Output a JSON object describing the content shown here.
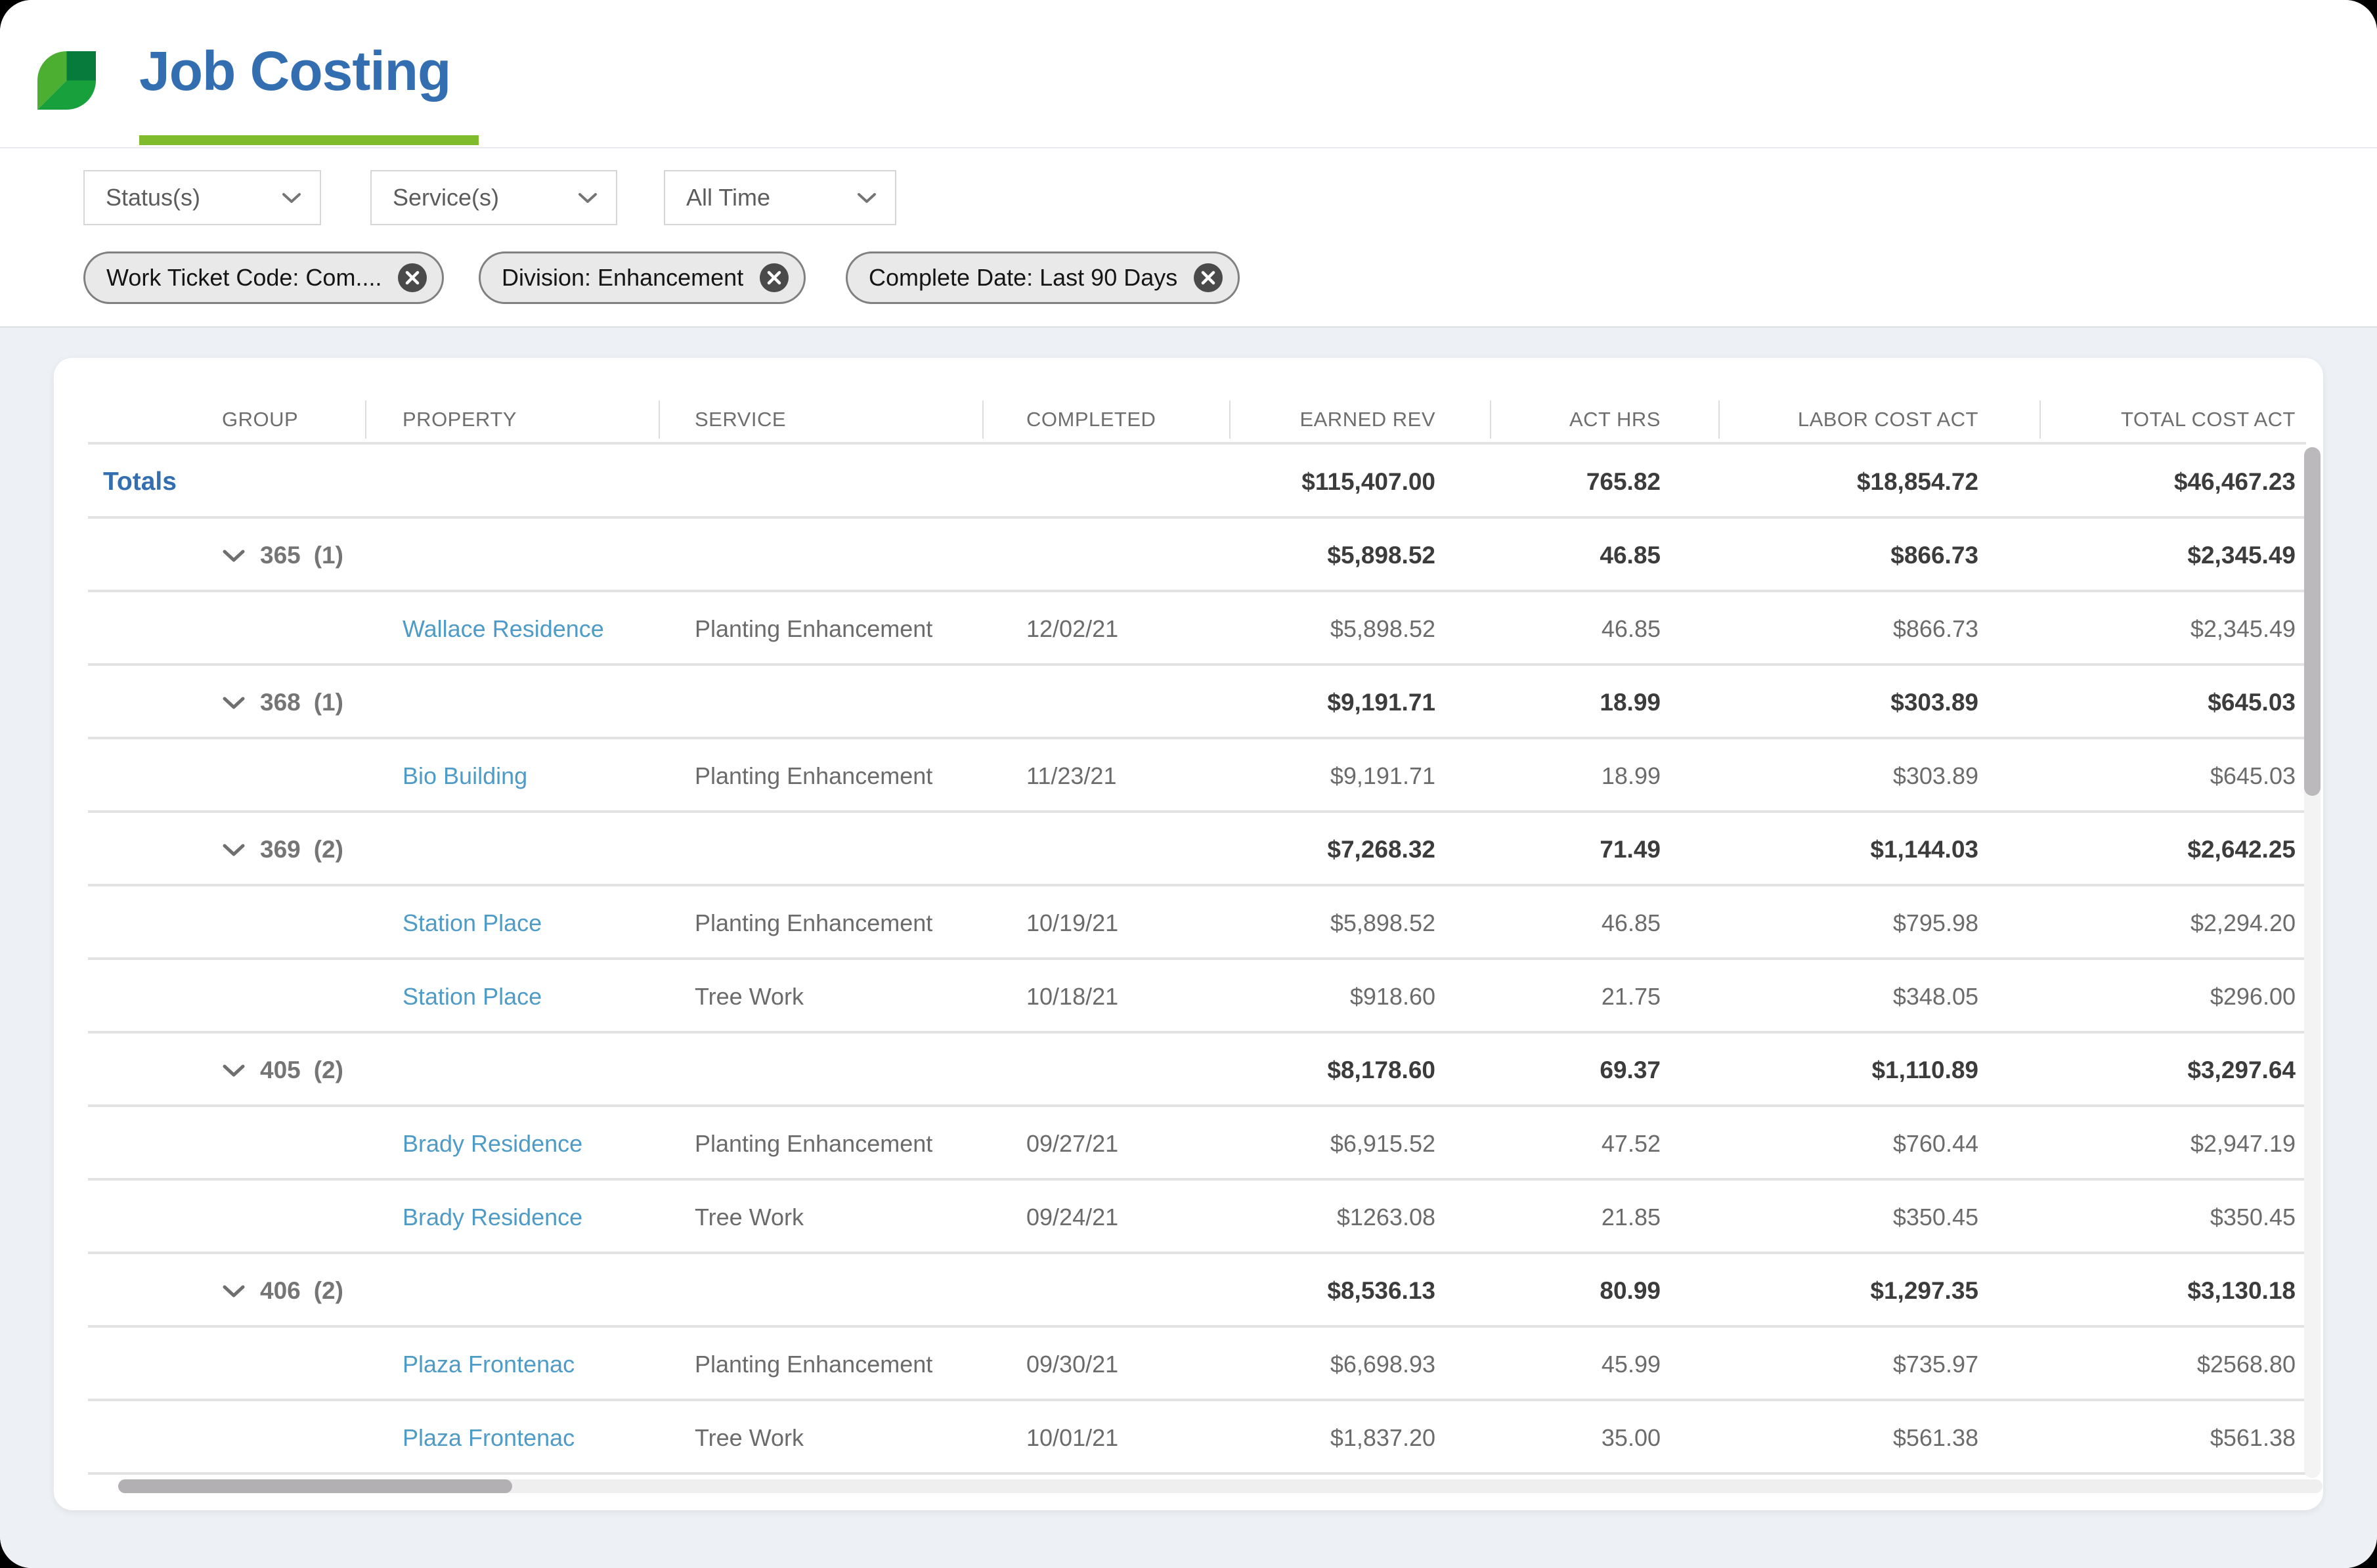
{
  "app": {
    "title": "Job Costing"
  },
  "colors": {
    "title_blue": "#336FB0",
    "brand_green_underline": "#80BB2D",
    "leaf_light_green": "#4DAF31",
    "leaf_mid_green": "#18A03C",
    "leaf_dark_green": "#077B3B",
    "link_blue": "#4E9BC8"
  },
  "filters": {
    "dropdowns": [
      {
        "label": "Status(s)"
      },
      {
        "label": "Service(s)"
      },
      {
        "label": "All Time"
      }
    ],
    "chips": [
      {
        "label": "Work Ticket Code: Com...."
      },
      {
        "label": "Division: Enhancement"
      },
      {
        "label": "Complete Date: Last 90 Days"
      }
    ]
  },
  "table": {
    "columns": [
      "GROUP",
      "PROPERTY",
      "SERVICE",
      "COMPLETED",
      "EARNED REV",
      "ACT HRS",
      "LABOR COST ACT",
      "TOTAL COST ACT"
    ],
    "totals": {
      "label": "Totals",
      "earned_rev": "$115,407.00",
      "act_hrs": "765.82",
      "labor_cost_act": "$18,854.72",
      "total_cost_act": "$46,467.23"
    },
    "rows": [
      {
        "type": "group",
        "group": "365",
        "count": "(1)",
        "earned_rev": "$5,898.52",
        "act_hrs": "46.85",
        "labor_cost_act": "$866.73",
        "total_cost_act": "$2,345.49"
      },
      {
        "type": "detail",
        "property": "Wallace Residence",
        "service": "Planting Enhancement",
        "completed": "12/02/21",
        "earned_rev": "$5,898.52",
        "act_hrs": "46.85",
        "labor_cost_act": "$866.73",
        "total_cost_act": "$2,345.49"
      },
      {
        "type": "group",
        "group": "368",
        "count": "(1)",
        "earned_rev": "$9,191.71",
        "act_hrs": "18.99",
        "labor_cost_act": "$303.89",
        "total_cost_act": "$645.03"
      },
      {
        "type": "detail",
        "property": "Bio Building",
        "service": "Planting Enhancement",
        "completed": "11/23/21",
        "earned_rev": "$9,191.71",
        "act_hrs": "18.99",
        "labor_cost_act": "$303.89",
        "total_cost_act": "$645.03"
      },
      {
        "type": "group",
        "group": "369",
        "count": "(2)",
        "earned_rev": "$7,268.32",
        "act_hrs": "71.49",
        "labor_cost_act": "$1,144.03",
        "total_cost_act": "$2,642.25"
      },
      {
        "type": "detail",
        "property": "Station Place",
        "service": "Planting Enhancement",
        "completed": "10/19/21",
        "earned_rev": "$5,898.52",
        "act_hrs": "46.85",
        "labor_cost_act": "$795.98",
        "total_cost_act": "$2,294.20"
      },
      {
        "type": "detail",
        "property": "Station Place",
        "service": "Tree Work",
        "completed": "10/18/21",
        "earned_rev": "$918.60",
        "act_hrs": "21.75",
        "labor_cost_act": "$348.05",
        "total_cost_act": "$296.00"
      },
      {
        "type": "group",
        "group": "405",
        "count": "(2)",
        "earned_rev": "$8,178.60",
        "act_hrs": "69.37",
        "labor_cost_act": "$1,110.89",
        "total_cost_act": "$3,297.64"
      },
      {
        "type": "detail",
        "property": "Brady Residence",
        "service": "Planting Enhancement",
        "completed": "09/27/21",
        "earned_rev": "$6,915.52",
        "act_hrs": "47.52",
        "labor_cost_act": "$760.44",
        "total_cost_act": "$2,947.19"
      },
      {
        "type": "detail",
        "property": "Brady Residence",
        "service": "Tree Work",
        "completed": "09/24/21",
        "earned_rev": "$1263.08",
        "act_hrs": "21.85",
        "labor_cost_act": "$350.45",
        "total_cost_act": "$350.45"
      },
      {
        "type": "group",
        "group": "406",
        "count": "(2)",
        "earned_rev": "$8,536.13",
        "act_hrs": "80.99",
        "labor_cost_act": "$1,297.35",
        "total_cost_act": "$3,130.18"
      },
      {
        "type": "detail",
        "property": "Plaza Frontenac",
        "service": "Planting Enhancement",
        "completed": "09/30/21",
        "earned_rev": "$6,698.93",
        "act_hrs": "45.99",
        "labor_cost_act": "$735.97",
        "total_cost_act": "$2568.80"
      },
      {
        "type": "detail",
        "property": "Plaza Frontenac",
        "service": "Tree Work",
        "completed": "10/01/21",
        "earned_rev": "$1,837.20",
        "act_hrs": "35.00",
        "labor_cost_act": "$561.38",
        "total_cost_act": "$561.38"
      }
    ]
  }
}
